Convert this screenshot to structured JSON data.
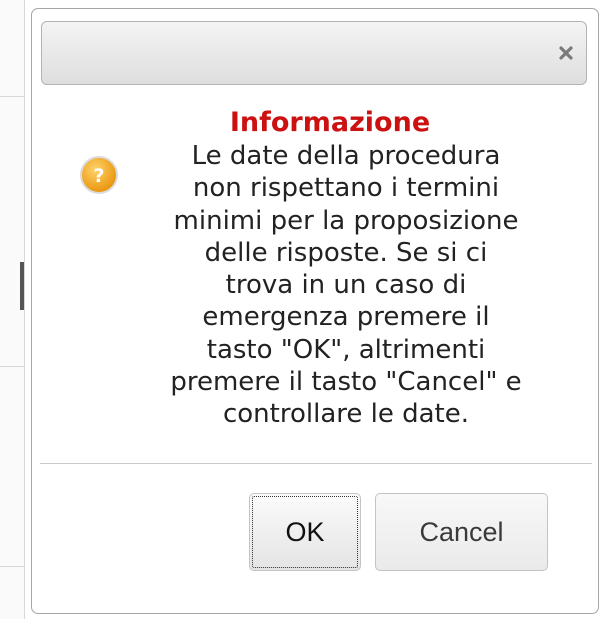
{
  "dialog": {
    "title": "Informazione",
    "message_lines": [
      "Le date della procedura",
      "non rispettano i termini",
      "minimi per la proposizione",
      "delle risposte. Se si ci",
      "trova in un caso di",
      "emergenza premere il",
      "tasto \"OK\", altrimenti",
      "premere il tasto \"Cancel\" e",
      "controllare le date."
    ],
    "ok_label": "OK",
    "cancel_label": "Cancel",
    "close_icon": "close-icon",
    "info_icon": "question-icon"
  },
  "colors": {
    "title": "#cc1111",
    "icon_fill": "#f2a516",
    "text": "#222222"
  }
}
